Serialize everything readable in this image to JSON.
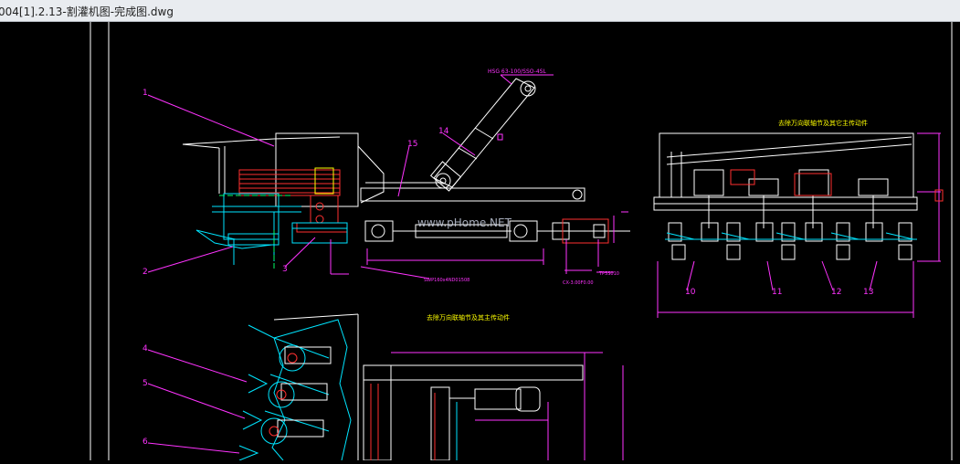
{
  "window": {
    "title": "004[1].2.13-割灌机图-完成图.dwg"
  },
  "drawing": {
    "watermark": "www.pHome.NET",
    "parts": [
      "1",
      "2",
      "3",
      "15",
      "14",
      "4",
      "5",
      "6",
      "10",
      "11",
      "12",
      "13"
    ],
    "annotations": {
      "cylinder_spec": "HSG 63-100/SSO-4SL",
      "section_title_right": "去除万向联轴节及其它主传动件",
      "section_title_mid": "去除万向联轴节及其主传动件",
      "shaft_spec": "SWP160x4ND01508",
      "dim_a": "CX-3.00F0.00",
      "dim_b": "TP5S010"
    }
  },
  "colors": {
    "frame": "#ffffff",
    "cyan": "#00e5ff",
    "magenta": "#ff33ff",
    "yellow": "#ffff00",
    "red": "#ff3030",
    "green": "#00ff66"
  }
}
